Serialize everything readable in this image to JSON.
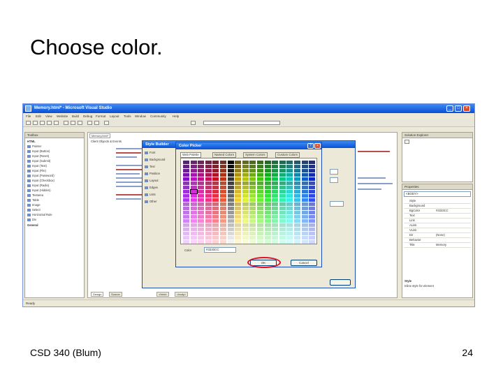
{
  "slide": {
    "title": "Choose color.",
    "footer_left": "CSD 340 (Blum)",
    "page_number": "24"
  },
  "window": {
    "title": "Memory.html* - Microsoft Visual Studio",
    "menus": [
      "File",
      "Edit",
      "View",
      "Website",
      "Build",
      "Debug",
      "Format",
      "Layout",
      "Tools",
      "Window",
      "Community",
      "Help"
    ]
  },
  "toolbox": {
    "title": "Toolbox",
    "section": "HTML",
    "items": [
      "Pointer",
      "Input (Button)",
      "Input (Reset)",
      "Input (Submit)",
      "Input (Text)",
      "Input (File)",
      "Input (Password)",
      "Input (Checkbox)",
      "Input (Radio)",
      "Input (Hidden)",
      "Textarea",
      "Table",
      "Image",
      "Select",
      "Horizontal Rule",
      "Div"
    ],
    "general": "General"
  },
  "editor": {
    "tab": "Memory.html*",
    "client_objects": "Client Objects & Events",
    "bottom_tabs": [
      "Design",
      "Source"
    ],
    "breadcrumb": [
      "<html>",
      "<body>"
    ]
  },
  "style_builder": {
    "title": "Style Builder",
    "sidebar": [
      "Font",
      "Background",
      "Text",
      "Position",
      "Layout",
      "Edges",
      "Lists",
      "Other"
    ]
  },
  "color_picker": {
    "title": "Color Picker",
    "tabs": [
      "Web Palette",
      "Named Colors",
      "System Colors",
      "Custom Colors"
    ],
    "color_label": "Color",
    "color_value": "#3333CC",
    "ok_label": "OK",
    "cancel_label": "Cancel"
  },
  "solution_explorer": {
    "title": "Solution Explorer"
  },
  "properties": {
    "title": "Properties",
    "object": "<BODY>",
    "rows": [
      {
        "key": "Style",
        "value": ""
      },
      {
        "key": "Background",
        "value": ""
      },
      {
        "key": "BgColor",
        "value": "#3333CC"
      },
      {
        "key": "Text",
        "value": ""
      },
      {
        "key": "Link",
        "value": ""
      },
      {
        "key": "ALink",
        "value": ""
      },
      {
        "key": "VLink",
        "value": ""
      },
      {
        "key": "Dir",
        "value": "(None)"
      },
      {
        "key": "Behavior",
        "value": ""
      },
      {
        "key": "Title",
        "value": "Memory"
      }
    ],
    "description_title": "Style",
    "description": "Inline style for element"
  },
  "statusbar": {
    "text": "Ready"
  },
  "colors": {
    "accent_red": "#e0102a",
    "titlebar_blue": "#0a4fd6",
    "selected_color": "#3333CC"
  }
}
